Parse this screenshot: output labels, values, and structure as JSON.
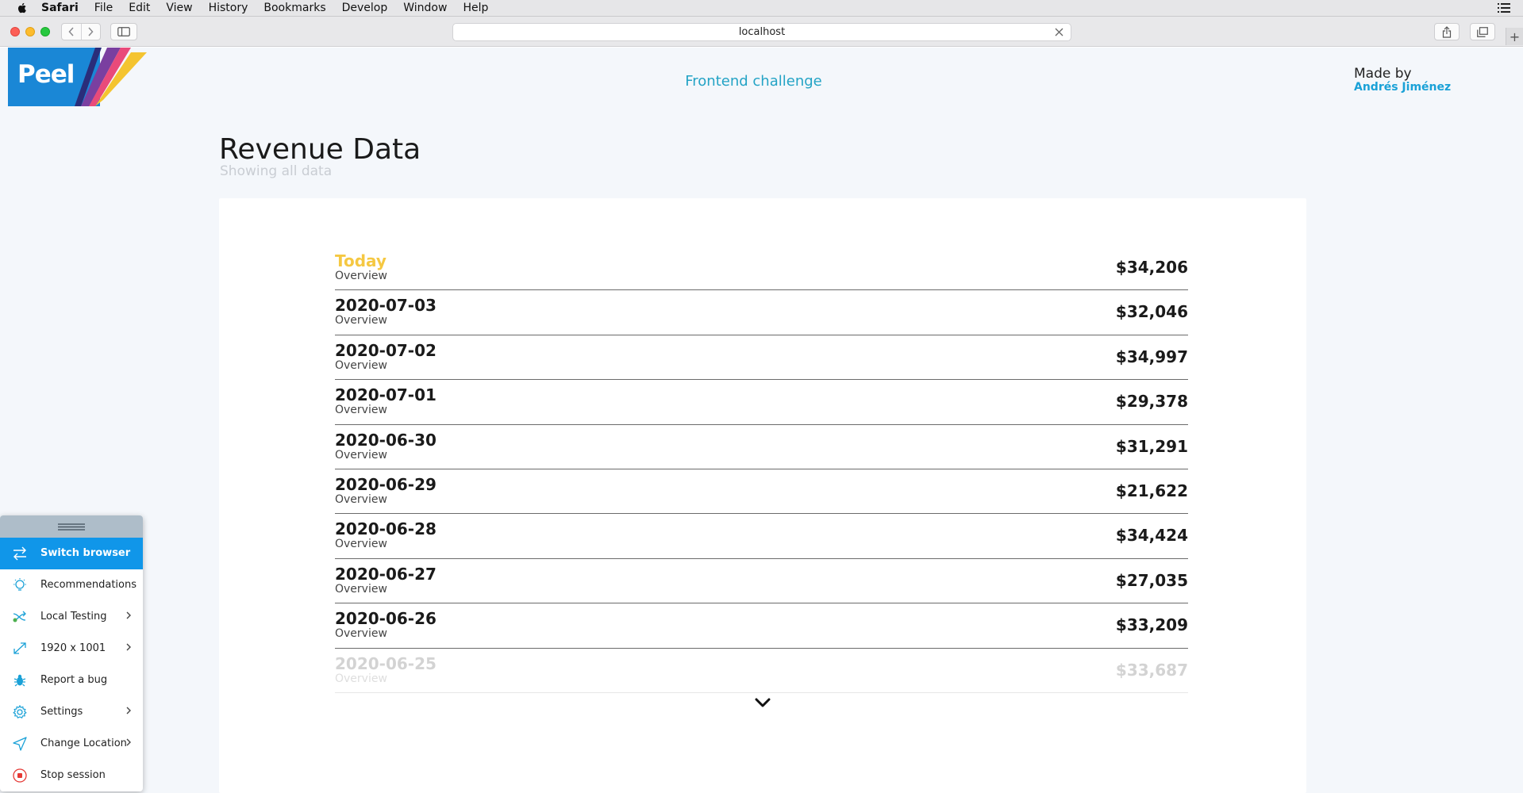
{
  "menubar": {
    "app": "Safari",
    "items": [
      "File",
      "Edit",
      "View",
      "History",
      "Bookmarks",
      "Develop",
      "Window",
      "Help"
    ]
  },
  "browser": {
    "url": "localhost"
  },
  "header": {
    "logo": "Peel",
    "center": "Frontend challenge",
    "made_by": "Made by",
    "author": "Andrés Jiménez"
  },
  "main": {
    "title": "Revenue Data",
    "subtitle": "Showing all data"
  },
  "rows": [
    {
      "date": "Today",
      "sub": "Overview",
      "amount": "$34,206"
    },
    {
      "date": "2020-07-03",
      "sub": "Overview",
      "amount": "$32,046"
    },
    {
      "date": "2020-07-02",
      "sub": "Overview",
      "amount": "$34,997"
    },
    {
      "date": "2020-07-01",
      "sub": "Overview",
      "amount": "$29,378"
    },
    {
      "date": "2020-06-30",
      "sub": "Overview",
      "amount": "$31,291"
    },
    {
      "date": "2020-06-29",
      "sub": "Overview",
      "amount": "$21,622"
    },
    {
      "date": "2020-06-28",
      "sub": "Overview",
      "amount": "$34,424"
    },
    {
      "date": "2020-06-27",
      "sub": "Overview",
      "amount": "$27,035"
    },
    {
      "date": "2020-06-26",
      "sub": "Overview",
      "amount": "$33,209"
    },
    {
      "date": "2020-06-25",
      "sub": "Overview",
      "amount": "$33,687"
    }
  ],
  "panel": {
    "items": [
      {
        "label": "Switch browser",
        "icon": "switch-icon"
      },
      {
        "label": "Recommendations",
        "icon": "lightbulb-icon"
      },
      {
        "label": "Local Testing",
        "icon": "local-testing-icon"
      },
      {
        "label": "1920 x 1001",
        "icon": "resize-icon"
      },
      {
        "label": "Report a bug",
        "icon": "bug-icon"
      },
      {
        "label": "Settings",
        "icon": "gear-icon"
      },
      {
        "label": "Change Location",
        "icon": "location-icon"
      },
      {
        "label": "Stop session",
        "icon": "stop-icon"
      }
    ]
  },
  "colors": {
    "brand_blue": "#1a87d6",
    "today_yellow": "#f5c842",
    "accent_cyan": "#23a3c5",
    "panel_active": "#1096e9"
  }
}
